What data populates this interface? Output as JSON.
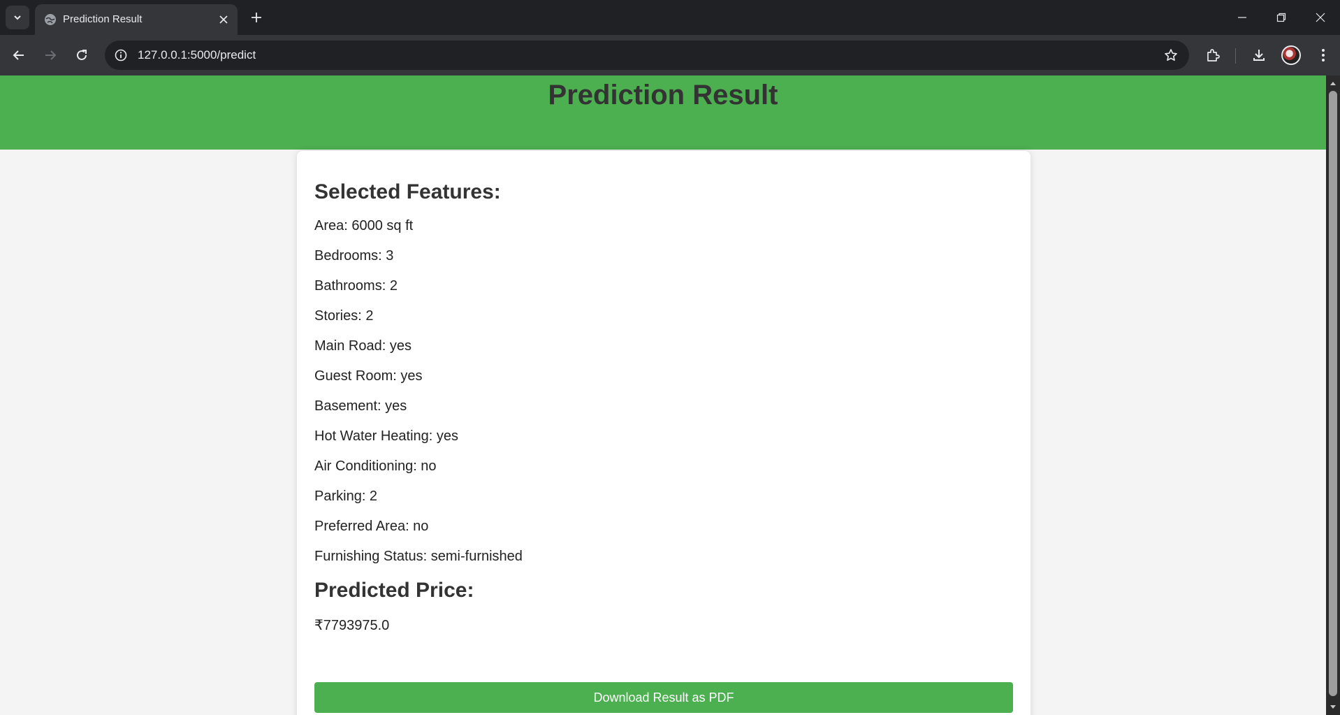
{
  "browser": {
    "tab_title": "Prediction Result",
    "url": "127.0.0.1:5000/predict"
  },
  "page": {
    "heading": "Prediction Result",
    "features_title": "Selected Features:",
    "features": [
      "Area: 6000 sq ft",
      "Bedrooms: 3",
      "Bathrooms: 2",
      "Stories: 2",
      "Main Road: yes",
      "Guest Room: yes",
      "Basement: yes",
      "Hot Water Heating: yes",
      "Air Conditioning: no",
      "Parking: 2",
      "Preferred Area: no",
      "Furnishing Status: semi-furnished"
    ],
    "price_title": "Predicted Price:",
    "price_value": "₹7793975.0",
    "download_label": "Download Result as PDF"
  },
  "colors": {
    "accent_green": "#4caf50",
    "heading_text": "#333333",
    "page_background": "#f4f4f4",
    "chrome_dark": "#202124",
    "chrome_toolbar": "#35363a"
  }
}
